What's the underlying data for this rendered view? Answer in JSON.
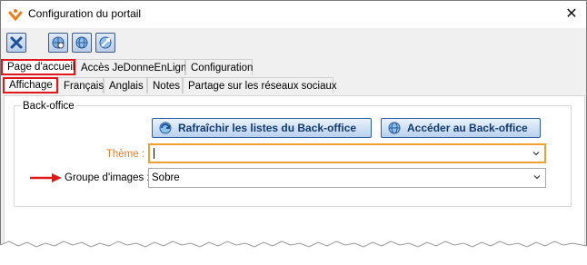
{
  "window": {
    "title": "Configuration du portail"
  },
  "toolbar": {
    "buttons": [
      {
        "icon": "close-x-icon"
      },
      {
        "icon": "settings-globe-icon"
      },
      {
        "icon": "globe-icon"
      },
      {
        "icon": "globe-link-icon"
      }
    ]
  },
  "tabs_main": [
    {
      "label": "Page d'accueil",
      "active": true
    },
    {
      "label": "Accès JeDonneEnLigne",
      "active": false
    },
    {
      "label": "Configuration",
      "active": false
    }
  ],
  "tabs_sub": [
    {
      "label": "Affichage",
      "active": true
    },
    {
      "label": "Français",
      "active": false
    },
    {
      "label": "Anglais",
      "active": false
    },
    {
      "label": "Notes",
      "active": false
    },
    {
      "label": "Partage sur les réseaux sociaux",
      "active": false
    }
  ],
  "backoffice": {
    "group_title": "Back-office",
    "refresh_label": "Rafraîchir les listes du Back-office",
    "access_label": "Accéder au Back-office"
  },
  "form": {
    "theme_label": "Thème :",
    "theme_value": "",
    "images_label": "Groupe d'images :",
    "images_value": "Sobre"
  },
  "colors": {
    "accent_red": "#e0181a",
    "focus_orange": "#f0a030",
    "theme_label": "#e87a1e"
  }
}
